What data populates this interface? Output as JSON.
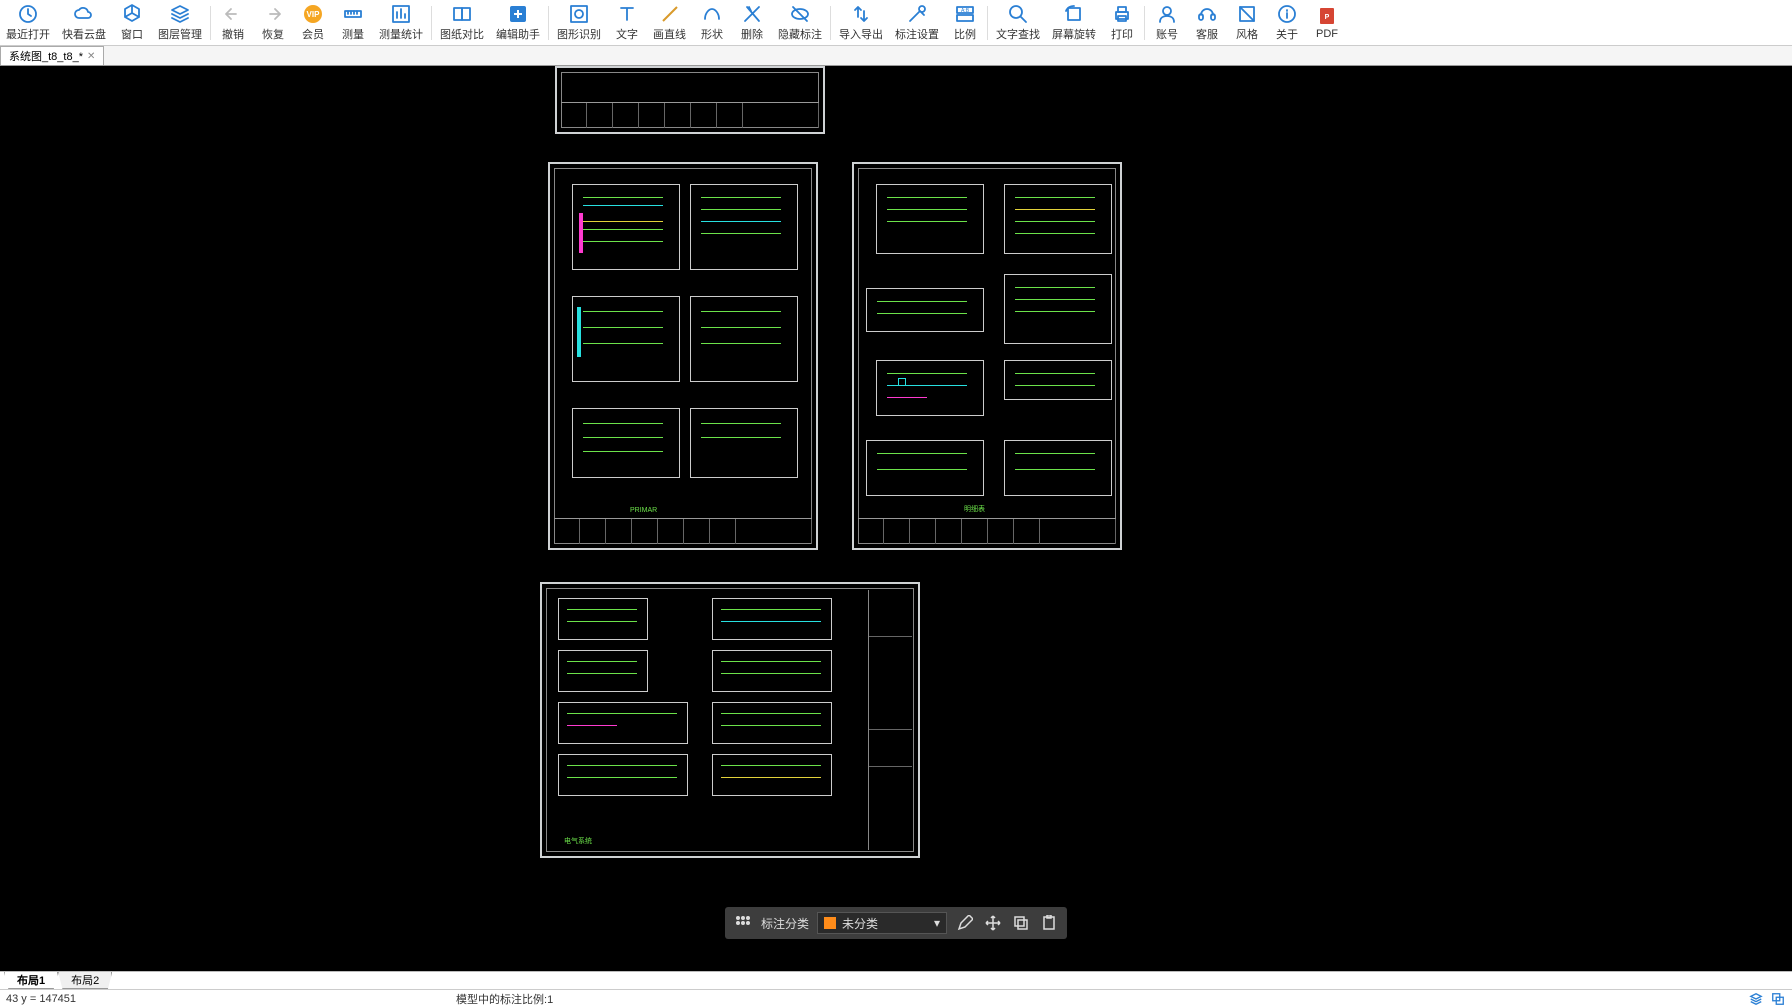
{
  "toolbar": [
    {
      "id": "recent-open",
      "label": "最近打开",
      "color": "#2a7fd4"
    },
    {
      "id": "cloud-disk",
      "label": "快看云盘",
      "color": "#2a7fd4"
    },
    {
      "id": "window",
      "label": "窗口",
      "color": "#2a7fd4"
    },
    {
      "id": "layer-mgr",
      "label": "图层管理",
      "color": "#2a7fd4"
    },
    {
      "sep": true
    },
    {
      "id": "undo",
      "label": "撤销",
      "color": "#bbb"
    },
    {
      "id": "redo",
      "label": "恢复",
      "color": "#bbb"
    },
    {
      "id": "vip",
      "label": "会员",
      "color": "#f5a623"
    },
    {
      "id": "measure",
      "label": "测量",
      "color": "#2a7fd4"
    },
    {
      "id": "measure-stat",
      "label": "测量统计",
      "color": "#2a7fd4"
    },
    {
      "sep": true
    },
    {
      "id": "compare",
      "label": "图纸对比",
      "color": "#2a7fd4"
    },
    {
      "id": "edit-asst",
      "label": "编辑助手",
      "color": "#2a7fd4"
    },
    {
      "sep": true
    },
    {
      "id": "shape-rec",
      "label": "图形识别",
      "color": "#2a7fd4"
    },
    {
      "id": "text",
      "label": "文字",
      "color": "#2a7fd4"
    },
    {
      "id": "line",
      "label": "画直线",
      "color": "#d99a2b"
    },
    {
      "id": "shape",
      "label": "形状",
      "color": "#2a7fd4"
    },
    {
      "id": "delete",
      "label": "删除",
      "color": "#2a7fd4"
    },
    {
      "id": "hide-ann",
      "label": "隐藏标注",
      "color": "#2a7fd4"
    },
    {
      "sep": true
    },
    {
      "id": "import-export",
      "label": "导入导出",
      "color": "#2a7fd4"
    },
    {
      "id": "ann-settings",
      "label": "标注设置",
      "color": "#2a7fd4"
    },
    {
      "id": "scale",
      "label": "比例",
      "color": "#2a7fd4"
    },
    {
      "sep": true
    },
    {
      "id": "find-text",
      "label": "文字查找",
      "color": "#2a7fd4"
    },
    {
      "id": "rotate",
      "label": "屏幕旋转",
      "color": "#2a7fd4"
    },
    {
      "id": "print",
      "label": "打印",
      "color": "#2a7fd4"
    },
    {
      "sep": true
    },
    {
      "id": "account",
      "label": "账号",
      "color": "#2a7fd4"
    },
    {
      "id": "support",
      "label": "客服",
      "color": "#2a7fd4"
    },
    {
      "id": "style",
      "label": "风格",
      "color": "#2a7fd4"
    },
    {
      "id": "about",
      "label": "关于",
      "color": "#2a7fd4"
    },
    {
      "id": "pdf",
      "label": "PDF",
      "color": "#d64533"
    }
  ],
  "file_tab": {
    "name": "系统图_t8_t8_*"
  },
  "float": {
    "label": "标注分类",
    "selected": "未分类"
  },
  "layout_tabs": [
    "布局1",
    "布局2"
  ],
  "status": {
    "coords": "43  y = 147451",
    "center": "模型中的标注比例:1"
  }
}
